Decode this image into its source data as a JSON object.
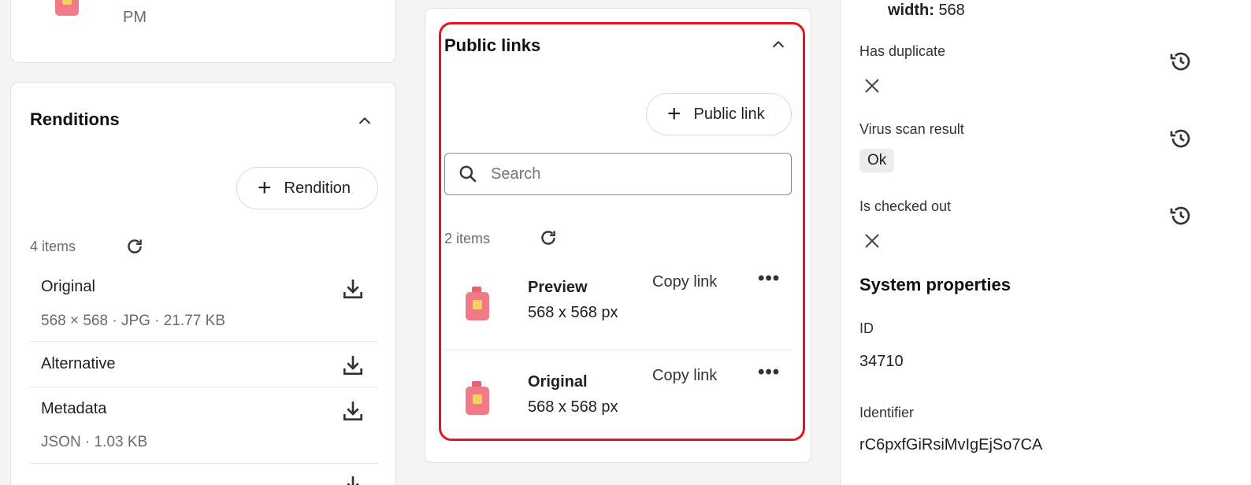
{
  "top_card": {
    "time_fragment": "PM"
  },
  "renditions": {
    "title": "Renditions",
    "add_label": "Rendition",
    "count": "4 items",
    "items": [
      {
        "name": "Original",
        "meta": "568 × 568 · JPG · 21.77 KB"
      },
      {
        "name": "Alternative",
        "meta": ""
      },
      {
        "name": "Metadata",
        "meta": "JSON · 1.03 KB"
      }
    ]
  },
  "public_links": {
    "title": "Public links",
    "add_label": "Public link",
    "search_placeholder": "Search",
    "count": "2 items",
    "copy_label": "Copy link",
    "items": [
      {
        "name": "Preview",
        "size": "568 x 568 px"
      },
      {
        "name": "Original",
        "size": "568 x 568 px"
      }
    ]
  },
  "properties": {
    "width_label": "width:",
    "width_value": "568",
    "has_duplicate_label": "Has duplicate",
    "virus_scan_label": "Virus scan result",
    "virus_scan_value": "Ok",
    "checked_out_label": "Is checked out",
    "system_title": "System properties",
    "id_label": "ID",
    "id_value": "34710",
    "identifier_label": "Identifier",
    "identifier_value": "rC6pxfGiRsiMvIgEjSo7CA"
  },
  "colors": {
    "highlight": "#e8131b",
    "thumb": "#f07a85"
  }
}
